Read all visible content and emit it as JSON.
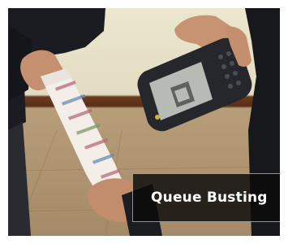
{
  "caption": {
    "text": "Queue Busting"
  },
  "photo": {
    "subject": "photo",
    "colors": {
      "wall": "#e7e0c7",
      "skirting": "#5e3219",
      "floor": "#ab916d",
      "sleeve_dark": "#1c1d22",
      "skin": "#c99473",
      "scanner_body": "#2a2b30",
      "scanner_screen": "#b8bcb6",
      "ticket": "#f3eee9",
      "caption_bg": "#111111"
    }
  }
}
